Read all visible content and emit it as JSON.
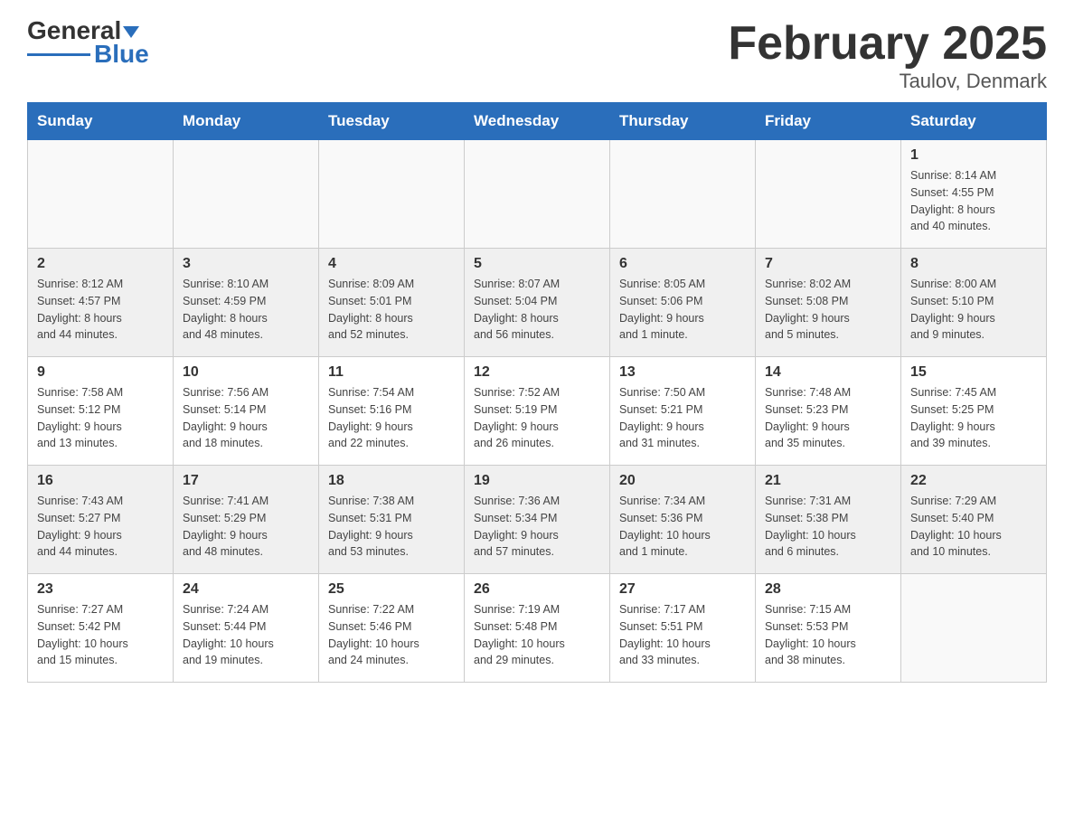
{
  "header": {
    "logo_text_black": "General",
    "logo_text_blue": "Blue",
    "title": "February 2025",
    "subtitle": "Taulov, Denmark"
  },
  "days_of_week": [
    "Sunday",
    "Monday",
    "Tuesday",
    "Wednesday",
    "Thursday",
    "Friday",
    "Saturday"
  ],
  "weeks": [
    [
      {
        "day": "",
        "info": ""
      },
      {
        "day": "",
        "info": ""
      },
      {
        "day": "",
        "info": ""
      },
      {
        "day": "",
        "info": ""
      },
      {
        "day": "",
        "info": ""
      },
      {
        "day": "",
        "info": ""
      },
      {
        "day": "1",
        "info": "Sunrise: 8:14 AM\nSunset: 4:55 PM\nDaylight: 8 hours\nand 40 minutes."
      }
    ],
    [
      {
        "day": "2",
        "info": "Sunrise: 8:12 AM\nSunset: 4:57 PM\nDaylight: 8 hours\nand 44 minutes."
      },
      {
        "day": "3",
        "info": "Sunrise: 8:10 AM\nSunset: 4:59 PM\nDaylight: 8 hours\nand 48 minutes."
      },
      {
        "day": "4",
        "info": "Sunrise: 8:09 AM\nSunset: 5:01 PM\nDaylight: 8 hours\nand 52 minutes."
      },
      {
        "day": "5",
        "info": "Sunrise: 8:07 AM\nSunset: 5:04 PM\nDaylight: 8 hours\nand 56 minutes."
      },
      {
        "day": "6",
        "info": "Sunrise: 8:05 AM\nSunset: 5:06 PM\nDaylight: 9 hours\nand 1 minute."
      },
      {
        "day": "7",
        "info": "Sunrise: 8:02 AM\nSunset: 5:08 PM\nDaylight: 9 hours\nand 5 minutes."
      },
      {
        "day": "8",
        "info": "Sunrise: 8:00 AM\nSunset: 5:10 PM\nDaylight: 9 hours\nand 9 minutes."
      }
    ],
    [
      {
        "day": "9",
        "info": "Sunrise: 7:58 AM\nSunset: 5:12 PM\nDaylight: 9 hours\nand 13 minutes."
      },
      {
        "day": "10",
        "info": "Sunrise: 7:56 AM\nSunset: 5:14 PM\nDaylight: 9 hours\nand 18 minutes."
      },
      {
        "day": "11",
        "info": "Sunrise: 7:54 AM\nSunset: 5:16 PM\nDaylight: 9 hours\nand 22 minutes."
      },
      {
        "day": "12",
        "info": "Sunrise: 7:52 AM\nSunset: 5:19 PM\nDaylight: 9 hours\nand 26 minutes."
      },
      {
        "day": "13",
        "info": "Sunrise: 7:50 AM\nSunset: 5:21 PM\nDaylight: 9 hours\nand 31 minutes."
      },
      {
        "day": "14",
        "info": "Sunrise: 7:48 AM\nSunset: 5:23 PM\nDaylight: 9 hours\nand 35 minutes."
      },
      {
        "day": "15",
        "info": "Sunrise: 7:45 AM\nSunset: 5:25 PM\nDaylight: 9 hours\nand 39 minutes."
      }
    ],
    [
      {
        "day": "16",
        "info": "Sunrise: 7:43 AM\nSunset: 5:27 PM\nDaylight: 9 hours\nand 44 minutes."
      },
      {
        "day": "17",
        "info": "Sunrise: 7:41 AM\nSunset: 5:29 PM\nDaylight: 9 hours\nand 48 minutes."
      },
      {
        "day": "18",
        "info": "Sunrise: 7:38 AM\nSunset: 5:31 PM\nDaylight: 9 hours\nand 53 minutes."
      },
      {
        "day": "19",
        "info": "Sunrise: 7:36 AM\nSunset: 5:34 PM\nDaylight: 9 hours\nand 57 minutes."
      },
      {
        "day": "20",
        "info": "Sunrise: 7:34 AM\nSunset: 5:36 PM\nDaylight: 10 hours\nand 1 minute."
      },
      {
        "day": "21",
        "info": "Sunrise: 7:31 AM\nSunset: 5:38 PM\nDaylight: 10 hours\nand 6 minutes."
      },
      {
        "day": "22",
        "info": "Sunrise: 7:29 AM\nSunset: 5:40 PM\nDaylight: 10 hours\nand 10 minutes."
      }
    ],
    [
      {
        "day": "23",
        "info": "Sunrise: 7:27 AM\nSunset: 5:42 PM\nDaylight: 10 hours\nand 15 minutes."
      },
      {
        "day": "24",
        "info": "Sunrise: 7:24 AM\nSunset: 5:44 PM\nDaylight: 10 hours\nand 19 minutes."
      },
      {
        "day": "25",
        "info": "Sunrise: 7:22 AM\nSunset: 5:46 PM\nDaylight: 10 hours\nand 24 minutes."
      },
      {
        "day": "26",
        "info": "Sunrise: 7:19 AM\nSunset: 5:48 PM\nDaylight: 10 hours\nand 29 minutes."
      },
      {
        "day": "27",
        "info": "Sunrise: 7:17 AM\nSunset: 5:51 PM\nDaylight: 10 hours\nand 33 minutes."
      },
      {
        "day": "28",
        "info": "Sunrise: 7:15 AM\nSunset: 5:53 PM\nDaylight: 10 hours\nand 38 minutes."
      },
      {
        "day": "",
        "info": ""
      }
    ]
  ]
}
